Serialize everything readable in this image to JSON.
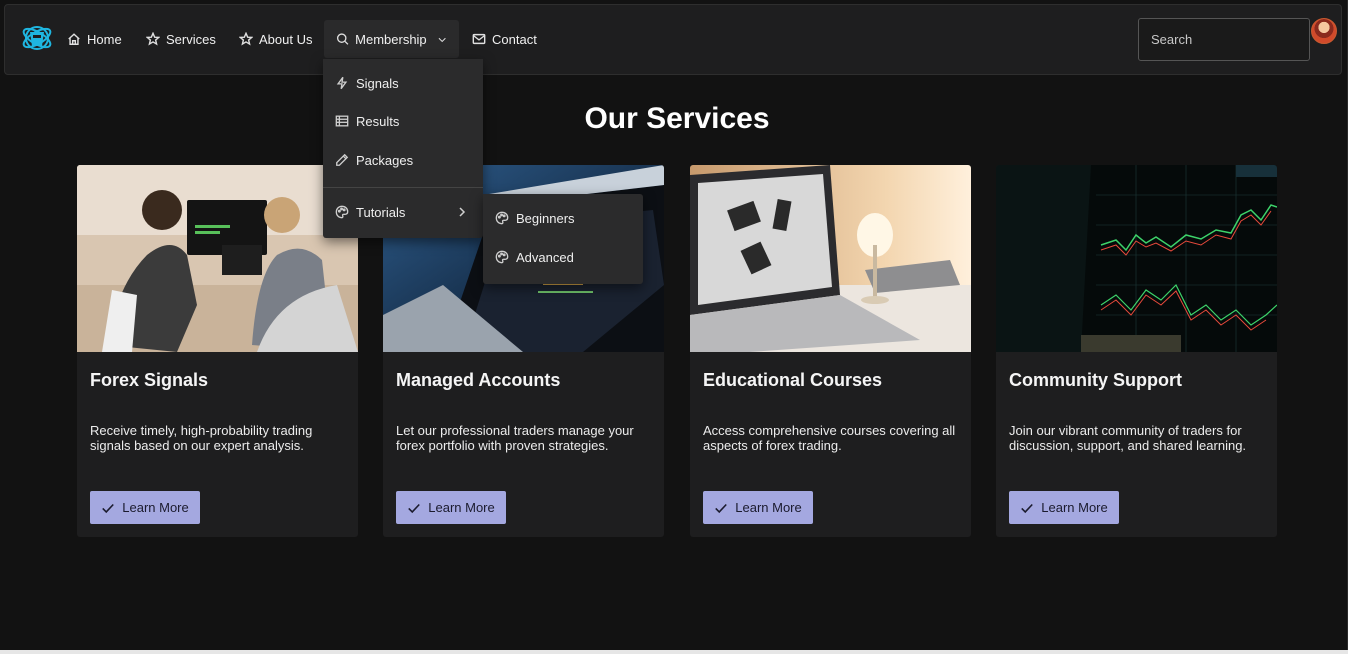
{
  "nav": {
    "items": [
      {
        "label": "Home",
        "icon": "home-icon"
      },
      {
        "label": "Services",
        "icon": "star-icon"
      },
      {
        "label": "About Us",
        "icon": "star-icon"
      },
      {
        "label": "Membership",
        "icon": "search-icon"
      },
      {
        "label": "Contact",
        "icon": "mail-icon"
      }
    ],
    "search_placeholder": "Search",
    "logo_icon": "logo-icon",
    "avatar_icon": "user-avatar"
  },
  "membership_menu": {
    "items": [
      {
        "label": "Signals",
        "icon": "lightning-icon"
      },
      {
        "label": "Results",
        "icon": "table-icon"
      },
      {
        "label": "Packages",
        "icon": "pencil-icon"
      },
      {
        "label": "Tutorials",
        "icon": "palette-icon"
      }
    ],
    "tutorials_submenu": [
      {
        "label": "Beginners",
        "icon": "palette-icon"
      },
      {
        "label": "Advanced",
        "icon": "palette-icon"
      }
    ]
  },
  "services": {
    "title": "Our Services",
    "cards": [
      {
        "title": "Forex Signals",
        "description": "Receive timely, high-probability trading signals based on our expert analysis.",
        "button": "Learn More"
      },
      {
        "title": "Managed Accounts",
        "description": "Let our professional traders manage your forex portfolio with proven strategies.",
        "button": "Learn More"
      },
      {
        "title": "Educational Courses",
        "description": "Access comprehensive courses covering all aspects of forex trading.",
        "button": "Learn More"
      },
      {
        "title": "Community Support",
        "description": "Join our vibrant community of traders for discussion, support, and shared learning.",
        "button": "Learn More"
      }
    ]
  },
  "colors": {
    "background": "#121212",
    "card": "#1e1e1f",
    "button": "#a4a8e0",
    "logo_accent": "#1fb6e0"
  }
}
